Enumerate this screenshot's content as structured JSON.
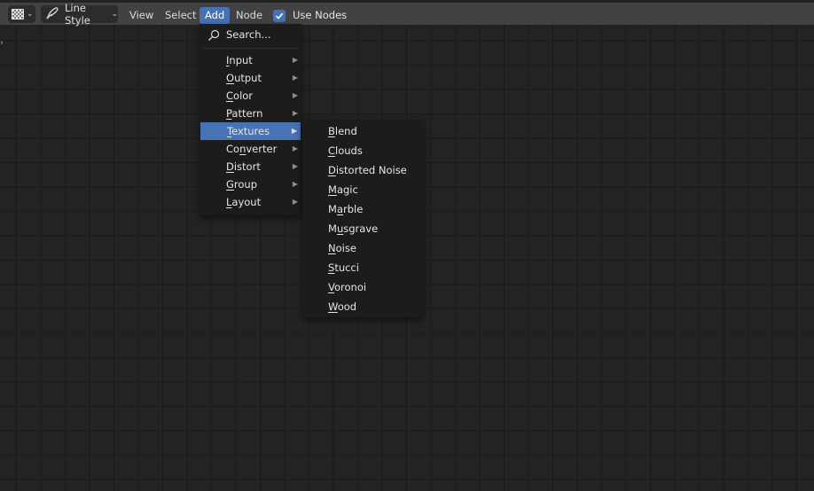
{
  "header": {
    "editor_type_icon": "texture-checker-icon",
    "linestyle_icon": "brush-stroke-icon",
    "linestyle_label": "Line Style",
    "menus": [
      {
        "label": "View"
      },
      {
        "label": "Select"
      },
      {
        "label": "Add",
        "active": true
      },
      {
        "label": "Node"
      }
    ],
    "use_nodes": {
      "label": "Use Nodes",
      "checked": true
    }
  },
  "add_menu": {
    "search_label": "Search...",
    "items": [
      {
        "label": "Input",
        "underline": "I"
      },
      {
        "label": "Output",
        "underline": "O"
      },
      {
        "label": "Color",
        "underline": "C"
      },
      {
        "label": "Pattern",
        "underline": "P"
      },
      {
        "label": "Textures",
        "underline": "T",
        "highlighted": true
      },
      {
        "label": "Converter",
        "underline": "n"
      },
      {
        "label": "Distort",
        "underline": "D"
      },
      {
        "label": "Group",
        "underline": "G"
      },
      {
        "label": "Layout",
        "underline": "L"
      }
    ]
  },
  "textures_submenu": {
    "items": [
      {
        "label": "Blend",
        "underline": "B"
      },
      {
        "label": "Clouds",
        "underline": "C"
      },
      {
        "label": "Distorted Noise",
        "underline": "D"
      },
      {
        "label": "Magic",
        "underline": "M"
      },
      {
        "label": "Marble",
        "underline": "a"
      },
      {
        "label": "Musgrave",
        "underline": "u"
      },
      {
        "label": "Noise",
        "underline": "N"
      },
      {
        "label": "Stucci",
        "underline": "S"
      },
      {
        "label": "Voronoi",
        "underline": "V"
      },
      {
        "label": "Wood",
        "underline": "W"
      }
    ]
  },
  "colors": {
    "accent": "#4772b3",
    "header_bg": "#424242",
    "editor_bg": "#232323",
    "menu_bg": "#1c1c1c"
  }
}
